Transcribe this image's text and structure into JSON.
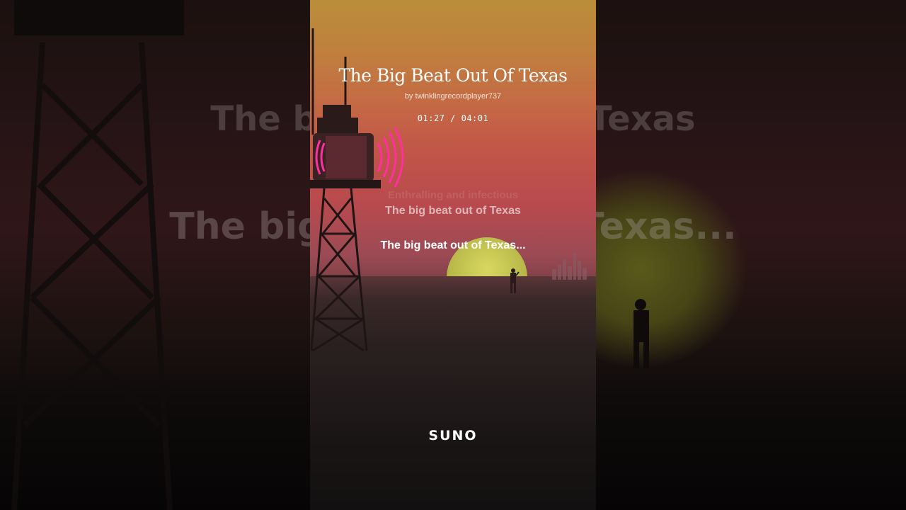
{
  "song": {
    "title": "The Big Beat Out Of Texas",
    "byline": "by twinklingrecordplayer737",
    "elapsed": "01:27",
    "separator": " / ",
    "duration": "04:01"
  },
  "lyrics": {
    "previous": "Enthralling and infectious",
    "dim": "The big beat out of Texas",
    "active": "The big beat out of Texas..."
  },
  "background": {
    "line1": "The big beat out of Texas",
    "line2": "The big beat out of Texas..."
  },
  "brand": {
    "logo_text": "SUNO"
  },
  "colors": {
    "neon": "#ff2fa0",
    "sun": "#c9c856"
  }
}
